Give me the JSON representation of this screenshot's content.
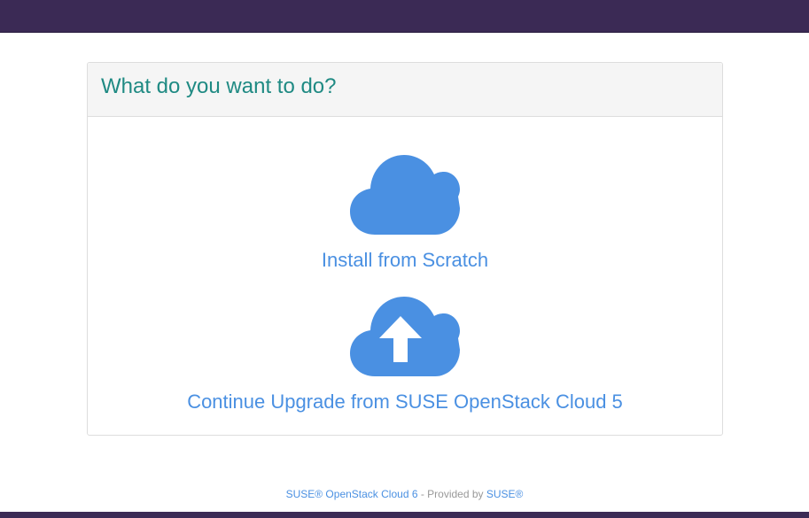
{
  "panel": {
    "title": "What do you want to do?"
  },
  "options": [
    {
      "label": "Install from Scratch",
      "icon": "cloud-icon"
    },
    {
      "label": "Continue Upgrade from SUSE OpenStack Cloud 5",
      "icon": "cloud-upload-icon"
    }
  ],
  "footer": {
    "product_link": "SUSE® OpenStack Cloud 6",
    "provided_by": " - Provided by ",
    "vendor_link": "SUSE®"
  },
  "colors": {
    "header_bar": "#3b2a55",
    "accent": "#4a90e2",
    "title": "#1f8a83"
  }
}
